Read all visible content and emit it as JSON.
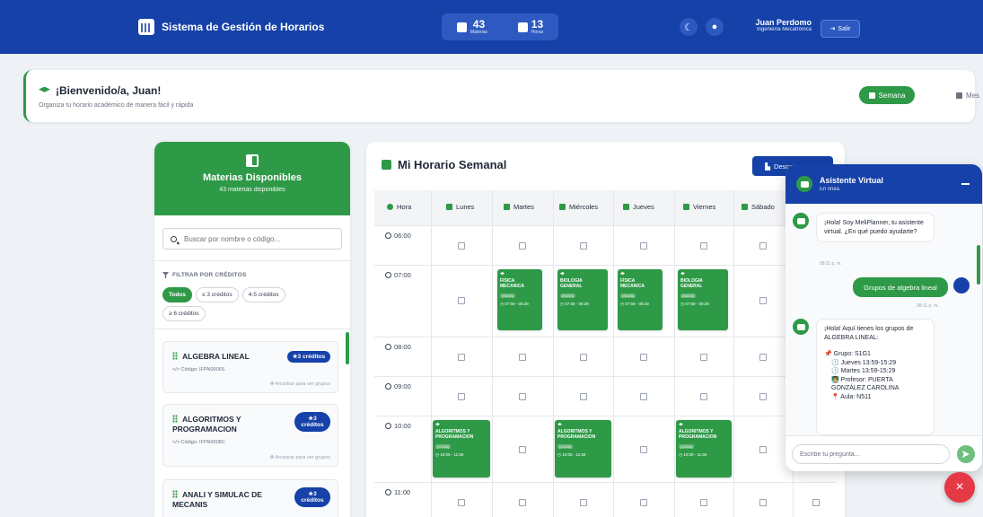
{
  "header": {
    "title": "Sistema de Gestión de Horarios",
    "stats": [
      {
        "value": "43",
        "label": "Materias",
        "icon": "book-icon"
      },
      {
        "value": "13",
        "label": "Horas",
        "icon": "calendar-icon"
      }
    ],
    "user_name": "Juan Perdomo",
    "user_program": "Ingeniería Mecatrónica",
    "logout_label": "Salir"
  },
  "welcome": {
    "title": "¡Bienvenido/a, Juan!",
    "subtitle": "Organiza tu horario académico de manera fácil y rápida",
    "view_week": "Semana",
    "view_month": "Mes"
  },
  "sidebar": {
    "title": "Materias Disponibles",
    "count": "43 materias disponibles",
    "search_placeholder": "Buscar por nombre o código...",
    "filter_label": "FILTRAR POR CRÉDITOS",
    "filters": [
      "Todos",
      "≤ 3 créditos",
      "4-5 créditos",
      "≥ 6 créditos"
    ],
    "courses": [
      {
        "name": "ALGEBRA LINEAL",
        "code": "Código: IFPN0006S",
        "credits": "3 créditos",
        "drag": "Arrastrar para ver grupos"
      },
      {
        "name": "ALGORITMOS Y PROGRAMACION",
        "code": "Código: IFPN0008C",
        "credits_num": "3",
        "credits_word": "créditos",
        "drag": "Arrastrar para ver grupos"
      },
      {
        "name": "ANALI Y SIMULAC DE MECANIS",
        "credits_num": "3",
        "credits_word": "créditos"
      }
    ]
  },
  "schedule": {
    "title": "Mi Horario Semanal",
    "pdf_label": "Descargar PDF",
    "hour_header": "Hora",
    "days": [
      "Lunes",
      "Martes",
      "Miércoles",
      "Jueves",
      "Viernes",
      "Sábado"
    ],
    "times": [
      "06:00",
      "07:00",
      "08:00",
      "09:00",
      "10:00",
      "11:00"
    ],
    "blocks": {
      "tue7": {
        "name": "FISICA MECANICA",
        "group": "(S1G3)",
        "time": "07:59 - 09:29"
      },
      "wed7": {
        "name": "BIOLOGIA GENERAL",
        "group": "(S1G3)",
        "time": "07:59 - 09:29"
      },
      "thu7": {
        "name": "FISICA MECANICA",
        "group": "(S1G3)",
        "time": "07:59 - 09:29"
      },
      "fri7": {
        "name": "BIOLOGIA GENERAL",
        "group": "(S1G3)",
        "time": "07:59 - 09:29"
      },
      "mon10": {
        "name": "ALGORITMOS Y PROGRAMACION",
        "group": "(C1G4)",
        "time": "10:00 - 11:59"
      },
      "wed10": {
        "name": "ALGORITMOS Y PROGRAMACION",
        "group": "(C1G4)",
        "time": "10:00 - 11:59"
      },
      "fri10": {
        "name": "ALGORITMOS Y PROGRAMACION",
        "group": "(C1G4)",
        "time": "10:00 - 11:59"
      }
    }
  },
  "chat": {
    "title": "Asistente Virtual",
    "status": "En línea",
    "msg1": "¡Hola! Soy MeliPlanner, tu asistente virtual. ¿En qué puedo ayudarte?",
    "msg1_time": "08:11 p. m.",
    "user_msg": "Grupos de algebra lineal",
    "user_msg_time": "08:11 p. m.",
    "msg2_intro": "¡Hola! Aquí tienes los grupos de ALGEBRA LINEAL:",
    "msg2_group": "📌 Grupo: S1G1",
    "msg2_slot1": "🕓 Jueves 13:59-15:29",
    "msg2_slot2": "🕓 Martes 13:59-15:29",
    "msg2_prof": "👨‍🏫 Profesor: PUERTA GONZÁLEZ CAROLINA",
    "msg2_room": "📍 Aula: N511",
    "input_placeholder": "Escribe tu pregunta..."
  },
  "close_label": "×"
}
